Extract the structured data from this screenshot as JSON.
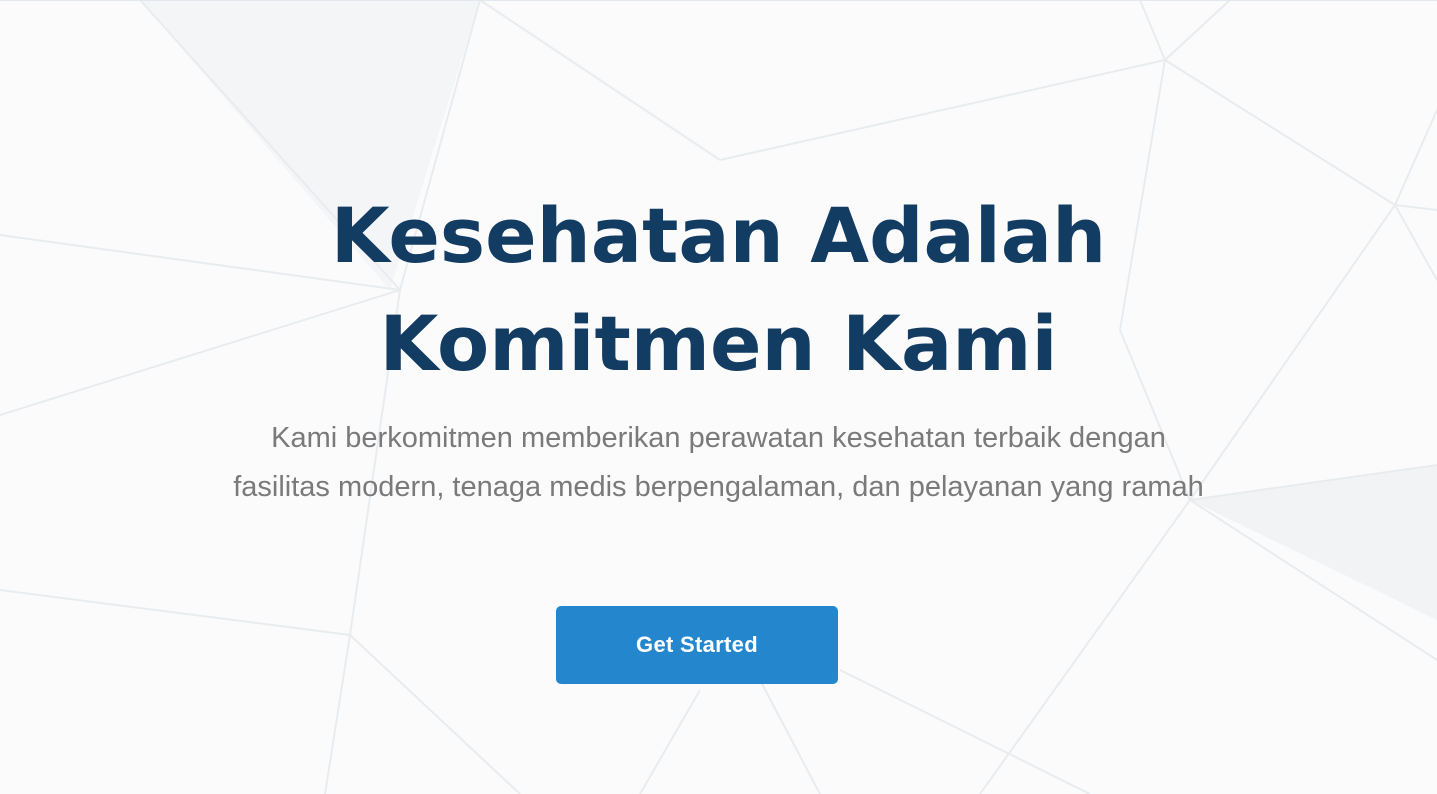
{
  "hero": {
    "title_line1": "Kesehatan Adalah",
    "title_line2": "Komitmen Kami",
    "subtitle": "Kami berkomitmen memberikan perawatan kesehatan terbaik dengan fasilitas modern, tenaga medis berpengalaman, dan pelayanan yang ramah",
    "cta_label": "Get Started"
  },
  "colors": {
    "title": "#133c63",
    "subtitle": "#7a7a7a",
    "cta_background": "#2487cd",
    "cta_text": "#ffffff",
    "background": "#fbfbfc"
  }
}
